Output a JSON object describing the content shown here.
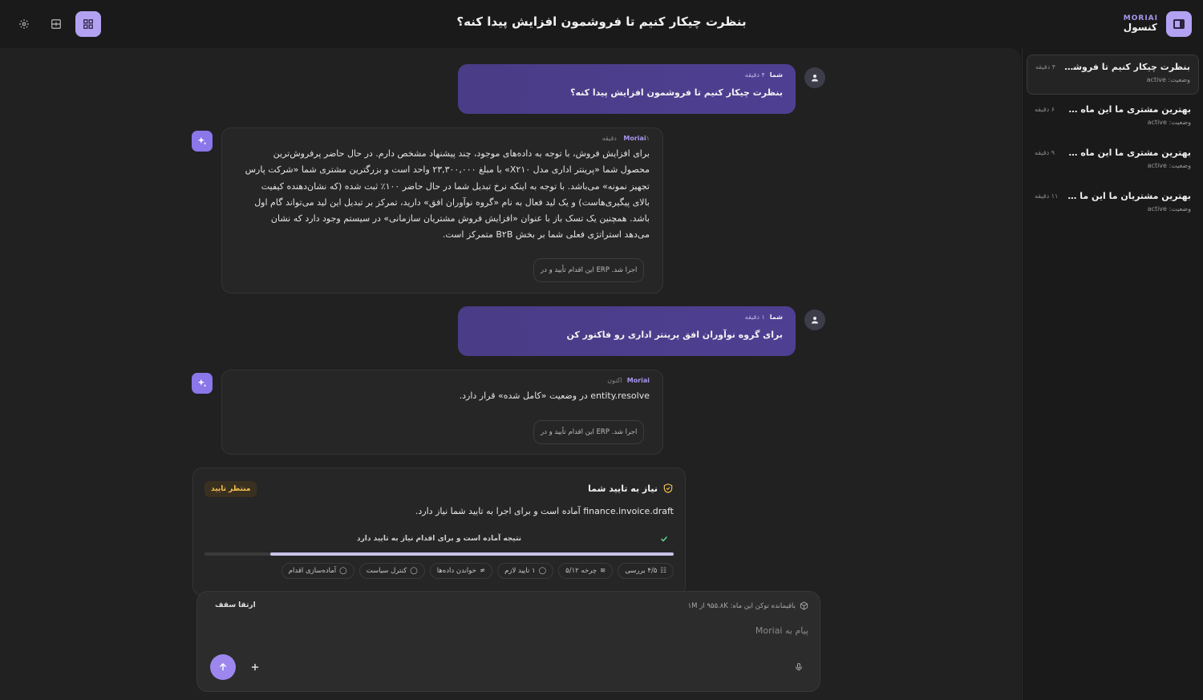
{
  "brand": {
    "name": "MORIAI",
    "subtitle": "کنسول"
  },
  "page_title": "بنظرت چیکار کنیم تا فروشمون افزایش پیدا کنه؟",
  "sidebar": {
    "conversations": [
      {
        "title": "بنظرت چیکار کنیم تا فروشمون افـ...",
        "time": "۴ دقیقه",
        "status": "وضعیت: active",
        "active": true
      },
      {
        "title": "بهترین مشتری ما این ماه چه کسـ...",
        "time": "۶ دقیقه",
        "status": "وضعیت: active",
        "active": false
      },
      {
        "title": "بهترین مشتری ما این ماه چه کسـ...",
        "time": "۹ دقیقه",
        "status": "وضعیت: active",
        "active": false
      },
      {
        "title": "بهترین مشتریان ما این ما چه کسـ...",
        "time": "۱۱ دقیقه",
        "status": "وضعیت: active",
        "active": false
      }
    ]
  },
  "messages": {
    "m1": {
      "sender": "شما",
      "time": "۴ دقیقه",
      "text": "بنظرت چیکار کنیم تا فروشمون افزایش پیدا کنه؟"
    },
    "m2": {
      "sender": "Moriai",
      "time": "۱ دقیقه",
      "lines": [
        "برای افزایش فروش، با توجه به داده‌های موجود، چند پیشنهاد مشخص دارم. در حال حاضر پرفروش‌ترین",
        "محصول شما «پرینتر اداری مدل X۲۱۰» با مبلغ ۲۳,۳۰۰,۰۰۰ واحد است و بزرگترین مشتری شما «شرکت پارس",
        "تجهیز نمونه» می‌باشد. با توجه به اینکه نرخ تبدیل شما در حال حاضر ۱۰۰٪ ثبت شده (که نشان‌دهنده کیفیت",
        "بالای پیگیری‌هاست) و یک لید فعال به نام «گروه نوآوران افق» دارید، تمرکز بر تبدیل این لید می‌تواند گام اول",
        "باشد. همچنین یک تسک باز با عنوان «افزایش فروش مشتریان سازمانی» در سیستم وجود دارد که نشان",
        "می‌دهد استراتژی فعلی شما بر بخش B۲B متمرکز است."
      ],
      "note": "اجرا شد. ERP این اقدام تأیید و در"
    },
    "m3": {
      "sender": "شما",
      "time": "۱ دقیقه",
      "text": "برای گروه نوآوران افق پرینتر اداری رو فاکتور کن"
    },
    "m4": {
      "sender": "Moriai",
      "time": "اکنون",
      "text": "entity.resolve در وضعیت «کامل شده» قرار دارد.",
      "note": "اجرا شد. ERP این اقدام تأیید و در"
    }
  },
  "approval": {
    "title": "نیاز به تایید شما",
    "badge": "منتظر تایید",
    "description": "finance.invoice.draft آماده است و برای اجرا به تایید شما نیاز دارد.",
    "result": "نتیجه آماده است و برای اقدام نیاز به تایید دارد",
    "progress": 0.86,
    "chips": [
      {
        "label": "۴/۵ بررسی",
        "icon": "review-icon"
      },
      {
        "label": "چرخه ۵/۱۲",
        "icon": "cycle-icon"
      },
      {
        "label": "۱ تایید لازم",
        "icon": "approval-icon"
      },
      {
        "label": "خواندن داده‌ها",
        "icon": "data-read-icon"
      },
      {
        "label": "کنترل سیاست",
        "icon": "policy-icon"
      },
      {
        "label": "آماده‌سازی اقدام",
        "icon": "prepare-icon"
      }
    ]
  },
  "composer": {
    "token_info": "باقیمانده توکن این ماه: ۹۵۵.۸K از ۱M",
    "upgrade": "ارتقا سقف",
    "placeholder": "پیام به Moriai",
    "value": ""
  },
  "colors": {
    "accent": "#9d87ef",
    "user_bubble": "#4c3e8c",
    "pending": "#f2c14e"
  }
}
